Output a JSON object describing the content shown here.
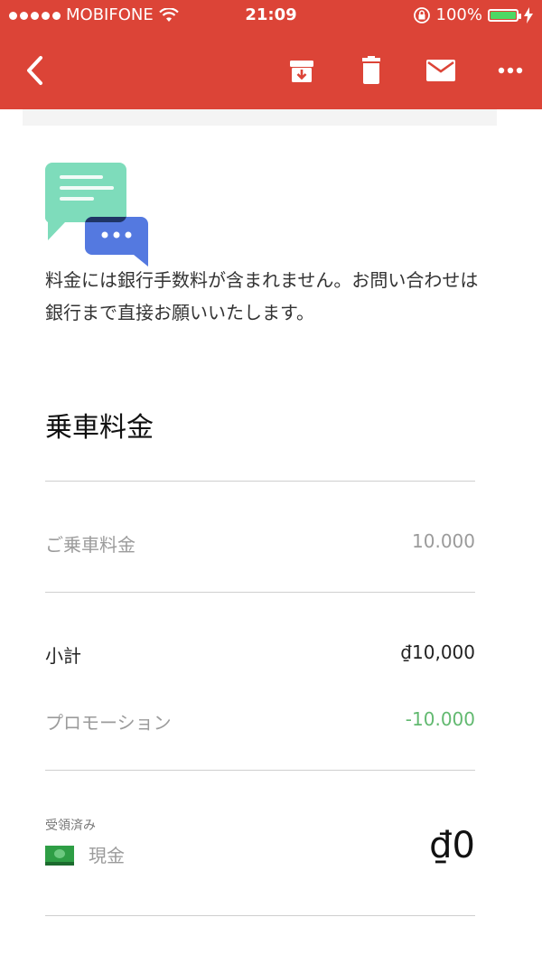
{
  "status_bar": {
    "carrier": "MOBIFONE",
    "time": "21:09",
    "battery": "100%"
  },
  "toolbar": {
    "back_icon": "chevron-left-icon",
    "archive_icon": "archive-icon",
    "delete_icon": "trash-icon",
    "mail_icon": "mail-icon",
    "more_icon": "more-horizontal-icon"
  },
  "notice": {
    "text": "料金には銀行手数料が含まれません。お問い合わせは銀行まで直接お願いいたします。"
  },
  "fare": {
    "title": "乗車料金",
    "ride_fare_label": "ご乗車料金",
    "ride_fare_value": "10.000",
    "subtotal_label": "小計",
    "subtotal_value": "₫10,000",
    "promotion_label": "プロモーション",
    "promotion_value": "-10.000"
  },
  "payment": {
    "received_label": "受領済み",
    "method_label": "現金",
    "total": "₫0"
  },
  "colors": {
    "appbar": "#dc4437",
    "promotion": "#62b970",
    "battery": "#4cd964"
  }
}
